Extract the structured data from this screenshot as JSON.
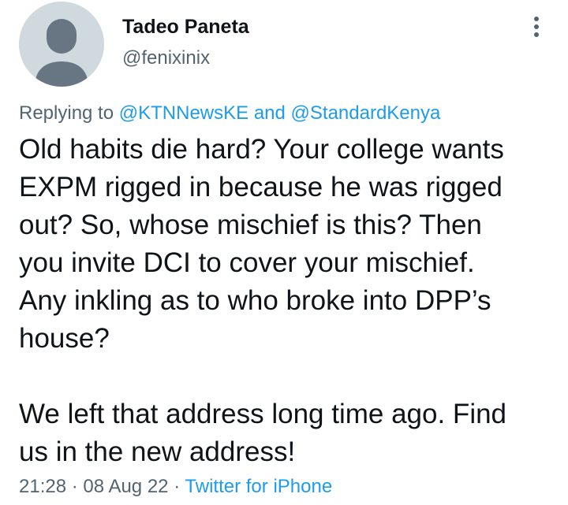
{
  "author": {
    "display_name": "Tadeo Paneta",
    "handle": "@fenixinix",
    "avatar_icon": "default-profile-icon"
  },
  "more_menu_icon": "vertical-ellipsis-icon",
  "reply_context": {
    "prefix": "Replying to",
    "mention_1": "@KTNNewsKE",
    "conjunction": "and",
    "mention_2": "@StandardKenya"
  },
  "tweet": {
    "paragraph_1": "Old habits die hard? Your college wants\nEXPM rigged in because he was rigged\nout? So, whose mischief is this? Then\nyou invite DCI to cover your mischief.\nAny inkling as to who broke into DPP’s\nhouse?",
    "paragraph_2": "We left that address long time ago. Find\nus in the new address!"
  },
  "meta": {
    "time": "21:28",
    "separator": "·",
    "date": "08 Aug 22",
    "source": "Twitter for iPhone"
  },
  "colors": {
    "link": "#1d9bf0",
    "secondary_text": "#536471",
    "primary_text": "#0f1419",
    "avatar_bg": "#cfd9de",
    "avatar_fg": "#687684"
  }
}
